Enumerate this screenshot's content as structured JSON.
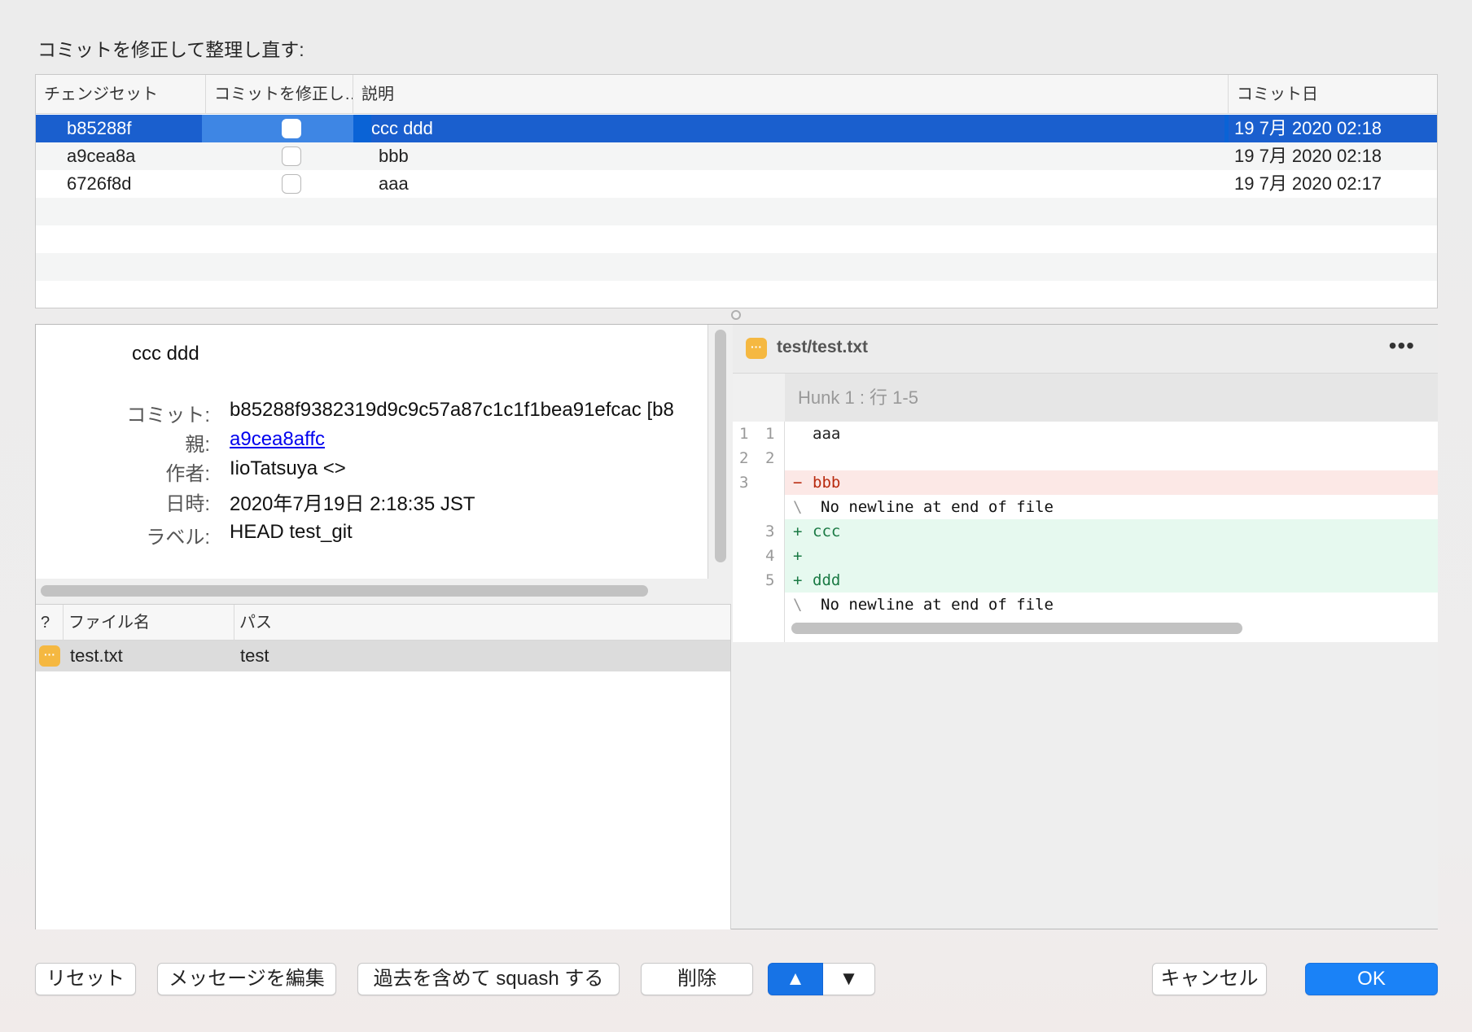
{
  "dialog": {
    "heading": "コミットを修正して整理し直す:"
  },
  "commit_table": {
    "columns": [
      "チェンジセット",
      "コミットを修正し…",
      "説明",
      "コミット日"
    ],
    "rows": [
      {
        "changeset": "b85288f",
        "description": "ccc ddd",
        "date": "19 7月 2020 02:18",
        "selected": true
      },
      {
        "changeset": "a9cea8a",
        "description": "bbb",
        "date": "19 7月 2020 02:18",
        "selected": false
      },
      {
        "changeset": "6726f8d",
        "description": "aaa",
        "date": "19 7月 2020 02:17",
        "selected": false
      }
    ]
  },
  "details": {
    "subject": "ccc ddd",
    "commit_label": "コミット:",
    "commit_value": "b85288f9382319d9c9c57a87c1c1f1bea91efcac [b8",
    "parent_label": "親:",
    "parent_value": "a9cea8affc",
    "author_label": "作者:",
    "author_value": "IioTatsuya <>",
    "date_label": "日時:",
    "date_value": "2020年7月19日 2:18:35 JST",
    "labels_label": "ラベル:",
    "labels_value": "HEAD test_git"
  },
  "files": {
    "columns": [
      "?",
      "ファイル名",
      "パス"
    ],
    "rows": [
      {
        "status": "modified",
        "status_glyph": "···",
        "name": "test.txt",
        "path": "test"
      }
    ]
  },
  "diff": {
    "file": "test/test.txt",
    "file_glyph": "···",
    "more_glyph": "•••",
    "hunk": "Hunk 1 : 行 1-5",
    "lines": [
      {
        "type": "ctx",
        "old": "1",
        "new": "1",
        "mark": "",
        "text": "aaa"
      },
      {
        "type": "ctx",
        "old": "2",
        "new": "2",
        "mark": "",
        "text": ""
      },
      {
        "type": "del",
        "old": "3",
        "new": "",
        "mark": "−",
        "text": "bbb"
      },
      {
        "type": "note",
        "old": "",
        "new": "",
        "mark": "\\",
        "text": "No newline at end of file"
      },
      {
        "type": "add",
        "old": "",
        "new": "3",
        "mark": "+",
        "text": "ccc"
      },
      {
        "type": "add",
        "old": "",
        "new": "4",
        "mark": "+",
        "text": ""
      },
      {
        "type": "add",
        "old": "",
        "new": "5",
        "mark": "+",
        "text": "ddd"
      },
      {
        "type": "note",
        "old": "",
        "new": "",
        "mark": "\\",
        "text": "No newline at end of file"
      }
    ]
  },
  "buttons": {
    "reset": "リセット",
    "edit_message": "メッセージを編集",
    "squash": "過去を含めて squash する",
    "delete": "削除",
    "up": "▲",
    "down": "▼",
    "cancel": "キャンセル",
    "ok": "OK"
  },
  "colors": {
    "selection": "#0a63d6",
    "primary_button": "#1a82f7",
    "status_modified": "#f5b841",
    "diff_deleted_bg": "#fce8e6",
    "diff_added_bg": "#e6f9ef"
  }
}
